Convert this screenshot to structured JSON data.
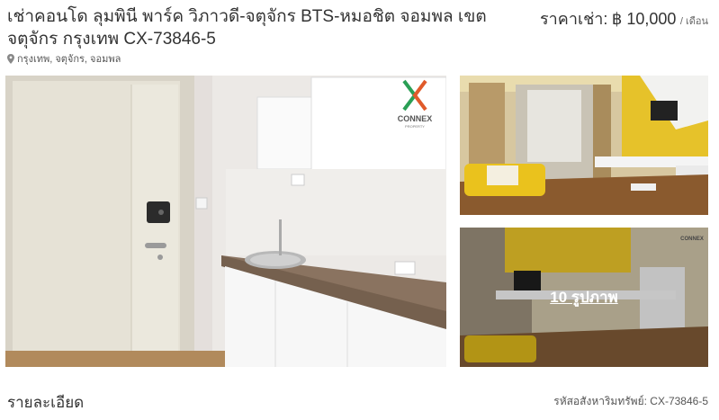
{
  "listing": {
    "title": "เช่าคอนโด ลุมพินี พาร์ค วิภาวดี-จตุจักร BTS-หมอชิต จอมพล เขต จตุจักร กรุงเทพ CX-73846-5",
    "price_label": "ราคาเช่า:",
    "price_value": "฿ 10,000",
    "price_unit": "/ เดือน",
    "location": "กรุงเทพ, จตุจักร, จอมพล"
  },
  "gallery": {
    "more_photos_label": "10 รูปภาพ",
    "watermark_brand": "CONNEX",
    "watermark_sub": "PROPERTY"
  },
  "details": {
    "section_title": "รายละเอียด",
    "property_code": "รหัสอสังหาริมทรัพย์: CX-73846-5"
  },
  "icons": {
    "location": "map-pin-icon"
  }
}
